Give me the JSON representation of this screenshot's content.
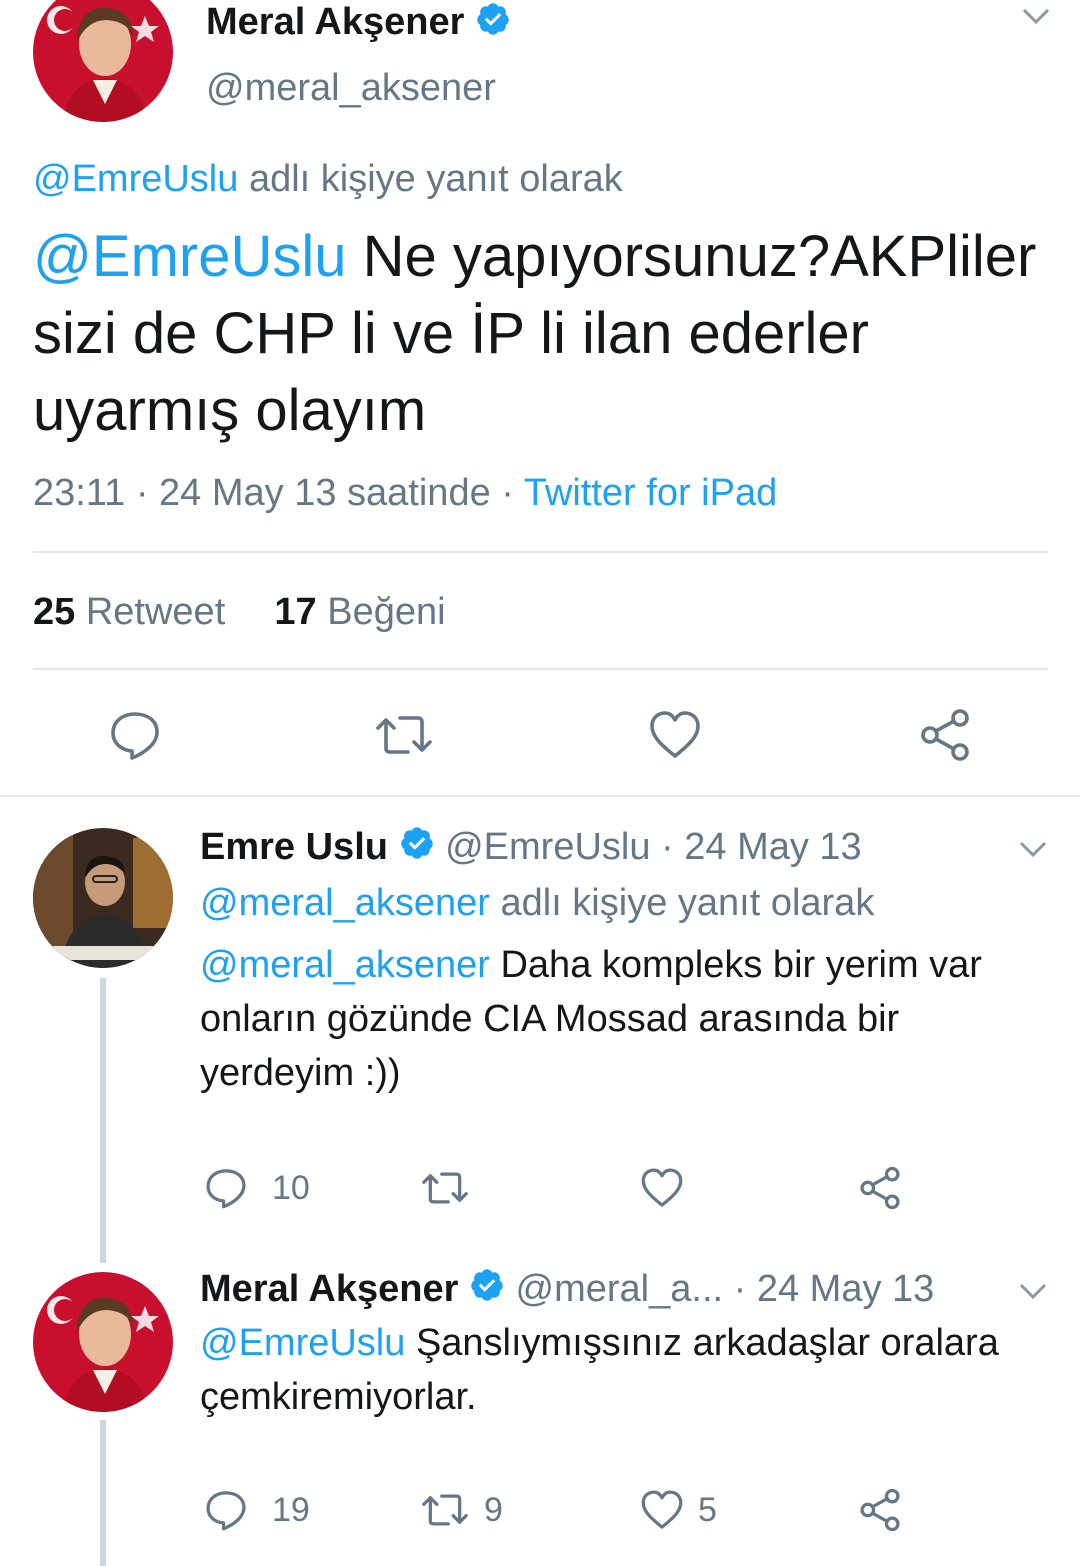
{
  "main_tweet": {
    "author_name": "Meral Akşener",
    "handle": "@meral_aksener",
    "reply_context": {
      "mention": "@EmreUslu",
      "suffix": " adlı kişiye yanıt olarak"
    },
    "text_mention": "@EmreUslu",
    "text_body": " Ne yapıyorsunuz?AKPliler sizi de CHP li ve İP li ilan ederler uyarmış olayım",
    "time": "23:11 · 24 May 13 saatinde · ",
    "source": "Twitter for iPad",
    "retweet_count": "25",
    "retweet_label": "Retweet",
    "like_count": "17",
    "like_label": "Beğeni"
  },
  "replies": [
    {
      "author_name": "Emre Uslu",
      "handle_date": "@EmreUslu · 24 May 13",
      "reply_context": {
        "mention": "@meral_aksener",
        "suffix": " adlı kişiye yanıt olarak"
      },
      "text_mention": "@meral_aksener",
      "text_body": " Daha kompleks bir yerim var onların gözünde CIA Mossad arasında bir yerdeyim :))",
      "reply_count": "10",
      "retweet_count": "",
      "like_count": ""
    },
    {
      "author_name": "Meral Akşener",
      "handle": "@meral_a...",
      "date": " · 24 May 13",
      "text_mention": "@EmreUslu",
      "text_body": " Şanslıymışsınız arkadaşlar oralara çemkiremiyorlar.",
      "reply_count": "19",
      "retweet_count": "9",
      "like_count": "5"
    }
  ],
  "colors": {
    "accent": "#1da1f2",
    "secondary_text": "#657786",
    "divider": "#e1e8ed",
    "thread_line": "#ccd6dd"
  },
  "icons": [
    "verified-badge-icon",
    "chevron-down-icon",
    "reply-icon",
    "retweet-icon",
    "like-icon",
    "share-icon"
  ]
}
